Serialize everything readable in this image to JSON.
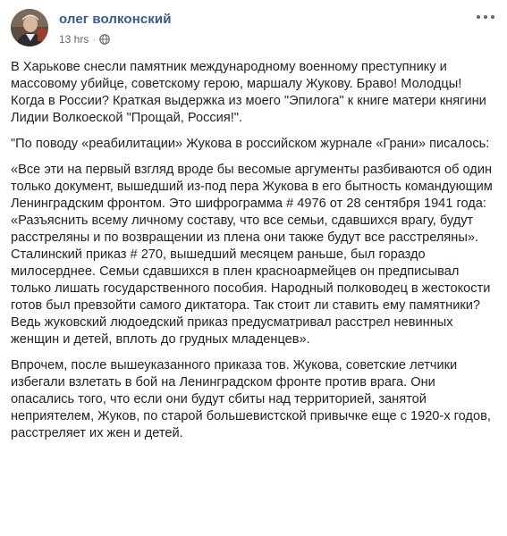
{
  "post": {
    "author": "олег волконский",
    "timestamp": "13 hrs",
    "separator": "·",
    "privacy_icon": "globe-icon",
    "menu_icon": "more-options-icon",
    "paragraphs": [
      "В Харькове снесли памятник международному военному преступнику и массовому убийце, советскому герою, маршалу Жукову. Браво! Молодцы! Когда в России? Краткая выдержка из моего \"Эпилога\" к книге матери княгини Лидии Волкоеской \"Прощай, Россия!\".",
      "\"По поводу «реабилитации» Жукова в российском журнале «Грани» писалось:",
      "«Все эти на первый взгляд вроде бы весомые аргументы разбиваются об один только документ, вышедший из-под пера Жукова в его бытность командующим Ленинградским фронтом. Это шифрограмма # 4976 от 28 сентября 1941 года: «Разъяснить всему личному составу, что все семьи, сдавшихся врагу, будут расстреляны и по возвращении из плена они также будут все расстреляны». Сталинский приказ # 270, вышедший месяцем раньше, был гораздо милосерднее. Семьи сдавшихся в плен красноармейцев он предписывал только лишать государственного пособия. Народный полководец в жестокости готов был превзойти самого диктатора. Так стоит ли ставить ему памятники? Ведь жуковский людоедский приказ предусматривал расстрел невинных женщин и детей, вплоть до грудных младенцев».",
      "Впрочем, после вышеуказанного приказа тов. Жукова, советские летчики избегали взлетать в бой на Ленинградском фронте против врага. Они опасались того, что если они будут сбиты над территорией, занятой неприятелем, Жуков, по старой большевистской привычке еще с 1920-х годов, расстреляет их жен и детей."
    ]
  }
}
